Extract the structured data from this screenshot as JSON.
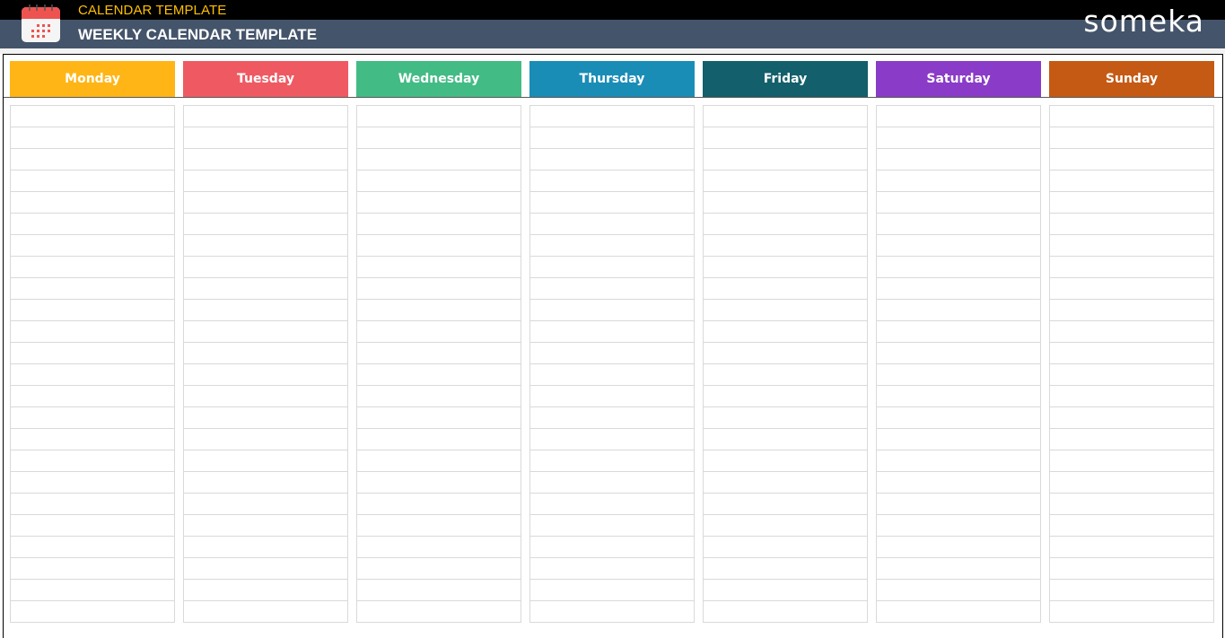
{
  "header": {
    "app_title": "CALENDAR TEMPLATE",
    "page_title": "WEEKLY CALENDAR TEMPLATE",
    "logo_text": "someka",
    "icon": "calendar-icon"
  },
  "colors": {
    "topbar": "#000000",
    "titlebar": "#44546a",
    "app_title": "#ffc000"
  },
  "days": [
    {
      "label": "Monday",
      "color": "#ffb515"
    },
    {
      "label": "Tuesday",
      "color": "#ef5a62"
    },
    {
      "label": "Wednesday",
      "color": "#43bb85"
    },
    {
      "label": "Thursday",
      "color": "#1a8db6"
    },
    {
      "label": "Friday",
      "color": "#135f6b"
    },
    {
      "label": "Saturday",
      "color": "#8a3bc7"
    },
    {
      "label": "Sunday",
      "color": "#c55a14"
    }
  ],
  "rows_per_day": 24
}
